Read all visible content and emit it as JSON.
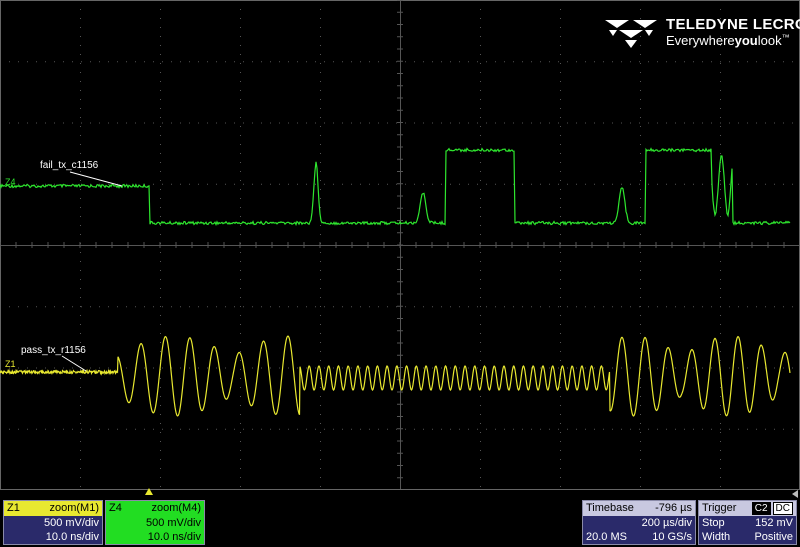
{
  "logo": {
    "brand": "TELEDYNE LECROY",
    "tag_pre": "Everywhere",
    "tag_bold": "you",
    "tag_post": "look",
    "tm": "™"
  },
  "traces": {
    "fail_label": "fail_tx_c1156",
    "pass_label": "pass_tx_r1156",
    "z4_marker": "Z4",
    "z1_marker": "Z1",
    "z4_color": "#2ee62e",
    "z1_color": "#e8e830"
  },
  "channels": [
    {
      "id": "Z1",
      "source": "zoom(M1)",
      "vdiv": "500 mV/div",
      "tdiv": "10.0 ns/div"
    },
    {
      "id": "Z4",
      "source": "zoom(M4)",
      "vdiv": "500 mV/div",
      "tdiv": "10.0 ns/div"
    }
  ],
  "timebase": {
    "label": "Timebase",
    "delay": "-796 µs",
    "tdiv": "200 µs/div",
    "samples": "20.0 MS",
    "rate": "10 GS/s"
  },
  "trigger": {
    "label": "Trigger",
    "source_badge": "C2",
    "coupling_badge": "DC",
    "mode": "Stop",
    "level": "152 mV",
    "type": "Width",
    "slope": "Positive"
  },
  "grid": {
    "h_divisions": 10,
    "v_divisions": 8
  }
}
